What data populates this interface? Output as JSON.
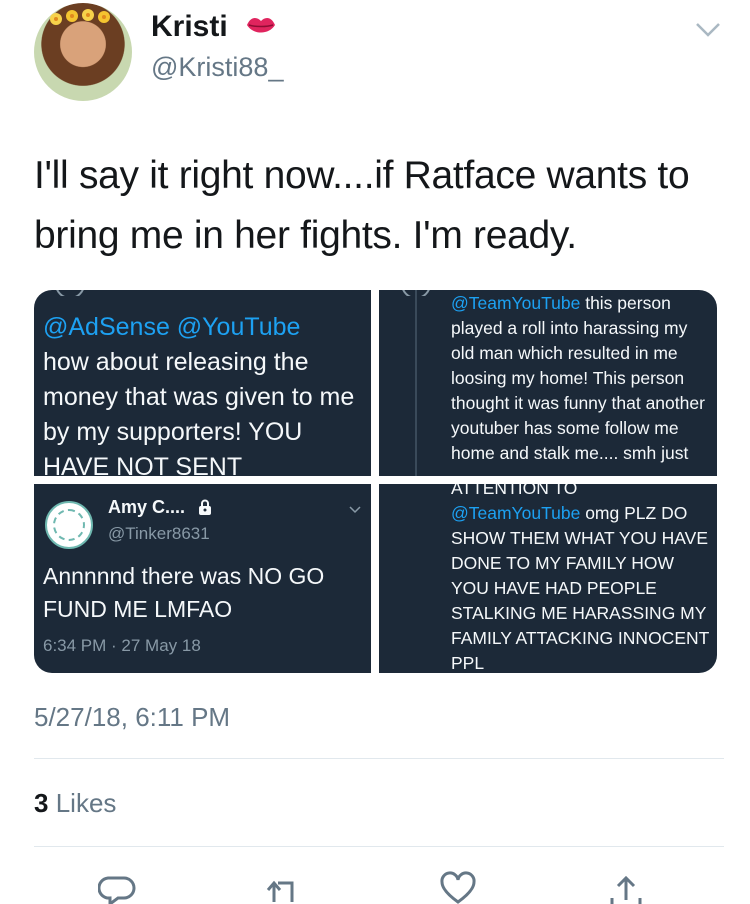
{
  "user": {
    "name": "Kristi",
    "handle": "@Kristi88_",
    "avatar_icon": "user-avatar",
    "badge_icon": "lips-emoji-icon"
  },
  "tweet": {
    "text": "I'll say it right now....if Ratface wants to bring me in her fights. I'm ready.",
    "timestamp": "5/27/18, 6:11 PM",
    "likes_count": "3",
    "likes_label": "Likes"
  },
  "images": {
    "panel1": {
      "mention1": "@AdSense",
      "mention2": "@YouTube",
      "text": "how about releasing the money that was given to me by my supporters! YOU HAVE NOT SENT"
    },
    "panel2": {
      "mention": "@TeamYouTube",
      "text": "this person played a roll into harassing my old man which resulted in me loosing my home! This person thought it was funny that another youtuber has some follow me home and stalk me.... smh just"
    },
    "panel3": {
      "name": "Amy C....",
      "handle": "@Tinker8631",
      "text": "Annnnnd there was NO GO FUND ME LMFAO",
      "time": "6:34 PM · 27 May 18"
    },
    "panel4": {
      "header": "ATTENTION TO",
      "mention": "@TeamYouTube",
      "text": "omg PLZ DO SHOW THEM WHAT YOU HAVE DONE TO MY FAMILY HOW YOU HAVE HAD PEOPLE STALKING ME HARASSING MY FAMILY ATTACKING INNOCENT PPL"
    }
  },
  "actions": {
    "reply_icon": "reply-icon",
    "retweet_icon": "retweet-icon",
    "like_icon": "heart-icon",
    "share_icon": "share-icon"
  },
  "colors": {
    "link_blue": "#1da1f2",
    "panel_bg": "#1c2938",
    "secondary_text": "#657786"
  }
}
